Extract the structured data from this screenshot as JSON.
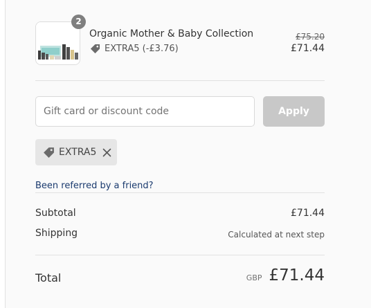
{
  "line_item": {
    "quantity": "2",
    "name": "Organic Mother & Baby Collection",
    "discount": "EXTRA5 (-£3.76)",
    "original_price": "£75.20",
    "price": "£71.44",
    "discount_icon": "tag-icon"
  },
  "discount_form": {
    "placeholder": "Gift card or discount code",
    "value": "",
    "apply_label": "Apply"
  },
  "applied_code": {
    "code": "EXTRA5",
    "icon": "tag-icon",
    "remove_icon": "close-icon"
  },
  "referral": {
    "label": "Been referred by a friend?"
  },
  "summary": {
    "subtotal_label": "Subtotal",
    "subtotal_value": "£71.44",
    "shipping_label": "Shipping",
    "shipping_value": "Calculated at next step",
    "total_label": "Total",
    "currency": "GBP",
    "total_value": "£71.44"
  },
  "colors": {
    "panel_bg": "#fafafa",
    "qty_badge": "#7f7f7f",
    "apply_disabled": "#c8c8c8",
    "chip_bg": "#e6e6e6",
    "link": "#1a3a6e"
  }
}
